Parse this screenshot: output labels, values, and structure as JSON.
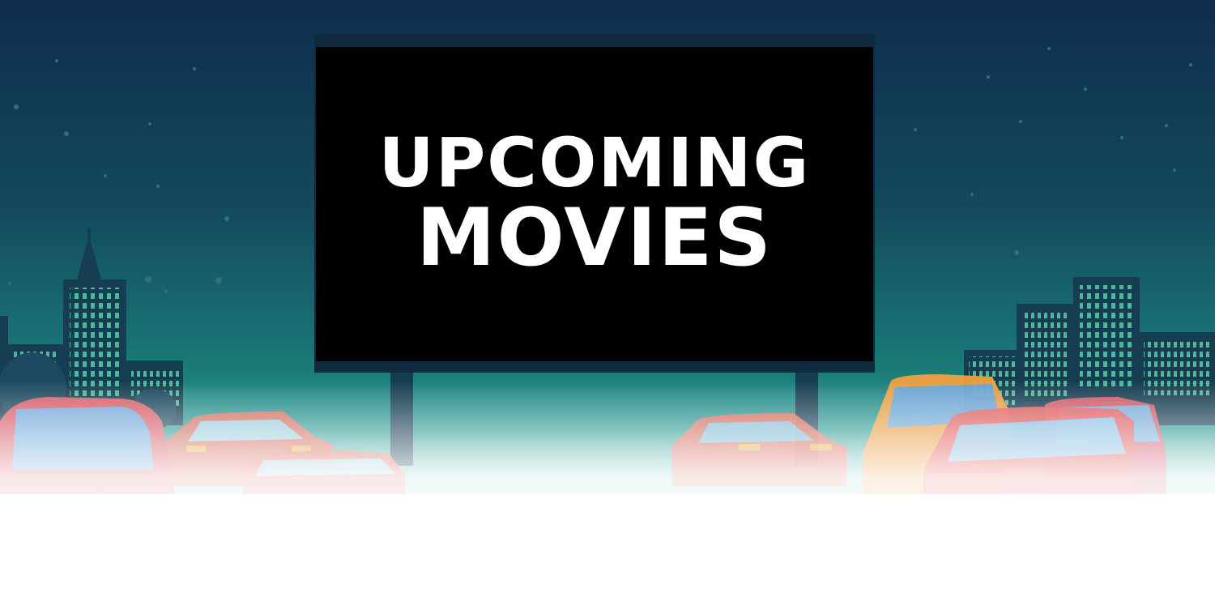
{
  "banner": {
    "title_line1": "UPCOMING",
    "title_line2": "MOVIES"
  },
  "colors": {
    "sky_top": "#0f2c4e",
    "sky_mid": "#17585f",
    "sky_low": "#1d8681",
    "building": "#163d52",
    "window": "#4fb89a",
    "screen": "#000000",
    "screen_frame": "#102a40",
    "fog": "#ffffff",
    "text": "#ffffff"
  },
  "icons": {
    "city_skyline": "city-skyline-icon",
    "drive_in_screen": "drive-in-screen-icon",
    "car": "car-icon"
  }
}
